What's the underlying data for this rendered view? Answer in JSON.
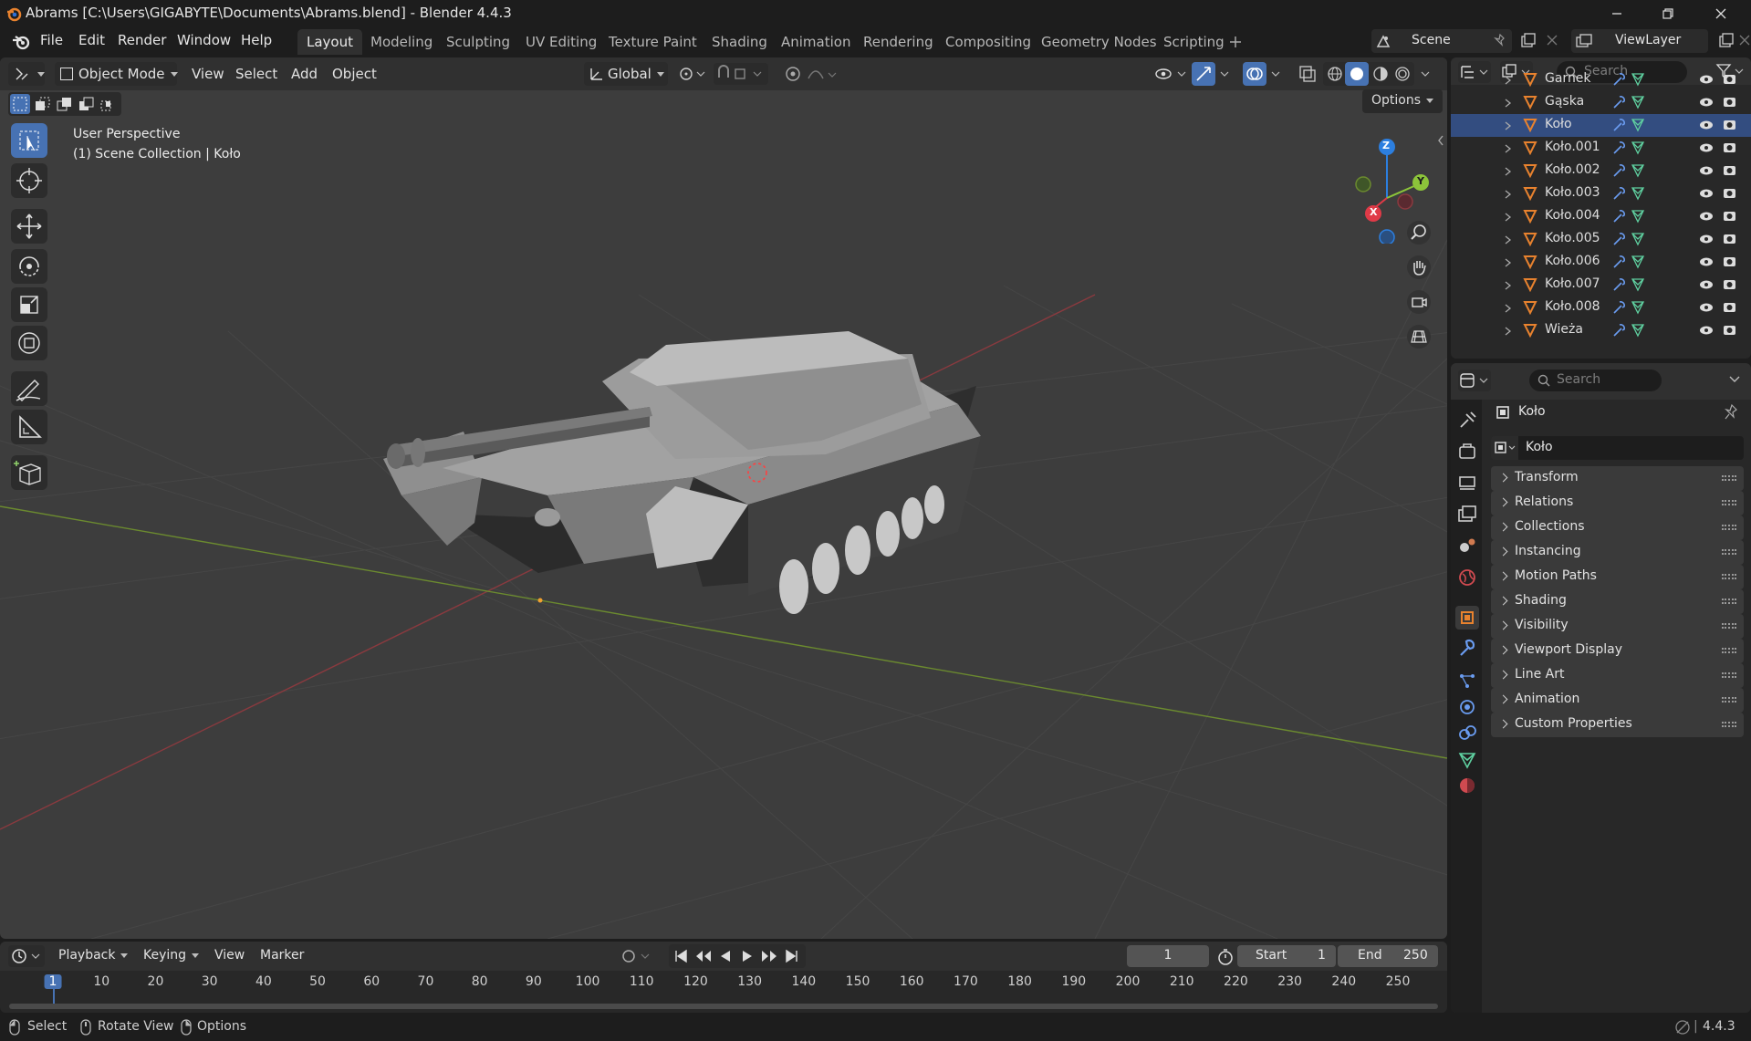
{
  "window": {
    "title": "Abrams [C:\\Users\\GIGABYTE\\Documents\\Abrams.blend] - Blender 4.4.3"
  },
  "menu": {
    "items": [
      "File",
      "Edit",
      "Render",
      "Window",
      "Help"
    ]
  },
  "workspaces": {
    "tabs": [
      "Layout",
      "Modeling",
      "Sculpting",
      "UV Editing",
      "Texture Paint",
      "Shading",
      "Animation",
      "Rendering",
      "Compositing",
      "Geometry Nodes",
      "Scripting"
    ],
    "active": "Layout"
  },
  "scene": {
    "name": "Scene",
    "view_layer": "ViewLayer"
  },
  "viewport": {
    "mode": "Object Mode",
    "menus": [
      "View",
      "Select",
      "Add",
      "Object"
    ],
    "orientation": "Global",
    "options_label": "Options",
    "info_line1": "User Perspective",
    "info_line2": "(1) Scene Collection | Koło",
    "gizmo_labels": {
      "x": "X",
      "y": "Y",
      "z": "Z"
    }
  },
  "outliner": {
    "search_placeholder": "Search",
    "items": [
      "Garnek",
      "Gąska",
      "Koło",
      "Koło.001",
      "Koło.002",
      "Koło.003",
      "Koło.004",
      "Koło.005",
      "Koło.006",
      "Koło.007",
      "Koło.008",
      "Wieża"
    ],
    "selected": "Koło"
  },
  "properties": {
    "search_placeholder": "Search",
    "object_name": "Koło",
    "object_field": "Koło",
    "panels": [
      "Transform",
      "Relations",
      "Collections",
      "Instancing",
      "Motion Paths",
      "Shading",
      "Visibility",
      "Viewport Display",
      "Line Art",
      "Animation",
      "Custom Properties"
    ]
  },
  "timeline": {
    "menus": [
      "Playback",
      "Keying",
      "View",
      "Marker"
    ],
    "current_frame": "1",
    "start_label": "Start",
    "start_value": "1",
    "end_label": "End",
    "end_value": "250",
    "ruler": [
      "1",
      "10",
      "20",
      "30",
      "40",
      "50",
      "60",
      "70",
      "80",
      "90",
      "100",
      "110",
      "120",
      "130",
      "140",
      "150",
      "160",
      "170",
      "180",
      "190",
      "200",
      "210",
      "220",
      "230",
      "240",
      "250"
    ]
  },
  "status": {
    "select": "Select",
    "rotate": "Rotate View",
    "options": "Options",
    "version": "4.4.3"
  },
  "colors": {
    "accent": "#4772b3",
    "active_object": "#e8822e",
    "axis_x": "#e03a47",
    "axis_y": "#8cc43a",
    "axis_z": "#2c7fe0",
    "mesh": "#e8822e",
    "modifier": "#6a9cf0",
    "data": "#5fd0a0"
  }
}
